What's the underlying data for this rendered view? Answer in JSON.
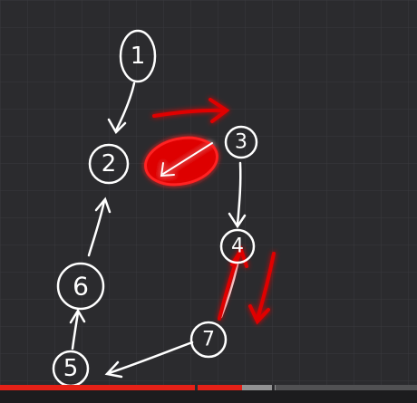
{
  "diagram": {
    "nodes": [
      {
        "id": "1",
        "label": "1"
      },
      {
        "id": "2",
        "label": "2"
      },
      {
        "id": "3",
        "label": "3"
      },
      {
        "id": "4",
        "label": "4"
      },
      {
        "id": "5",
        "label": "5"
      },
      {
        "id": "6",
        "label": "6"
      },
      {
        "id": "7",
        "label": "7"
      }
    ],
    "edges": [
      {
        "from": "1",
        "to": "2",
        "color": "white"
      },
      {
        "from": "3",
        "to": "4",
        "color": "white"
      },
      {
        "from": "4",
        "to": "7",
        "color": "white"
      },
      {
        "from": "7",
        "to": "5",
        "color": "white"
      },
      {
        "from": "5",
        "to": "6",
        "color": "white"
      },
      {
        "from": "6",
        "to": "2",
        "color": "white"
      }
    ],
    "annotations": [
      {
        "type": "highlighted-edge",
        "between": [
          "2",
          "3"
        ],
        "direction": "2 to 3",
        "color": "red"
      },
      {
        "type": "highlighted-edge",
        "between": [
          "4",
          "7"
        ],
        "direction": "bidirectional",
        "color": "red"
      }
    ]
  },
  "colors": {
    "background": "#2b2b2e",
    "grid": "#3a3a3d",
    "ink": "#ffffff",
    "highlight": "#e00000",
    "progress_played": "#e62117"
  },
  "video": {
    "progress_played": 0.58,
    "progress_buffered": 0.66
  }
}
